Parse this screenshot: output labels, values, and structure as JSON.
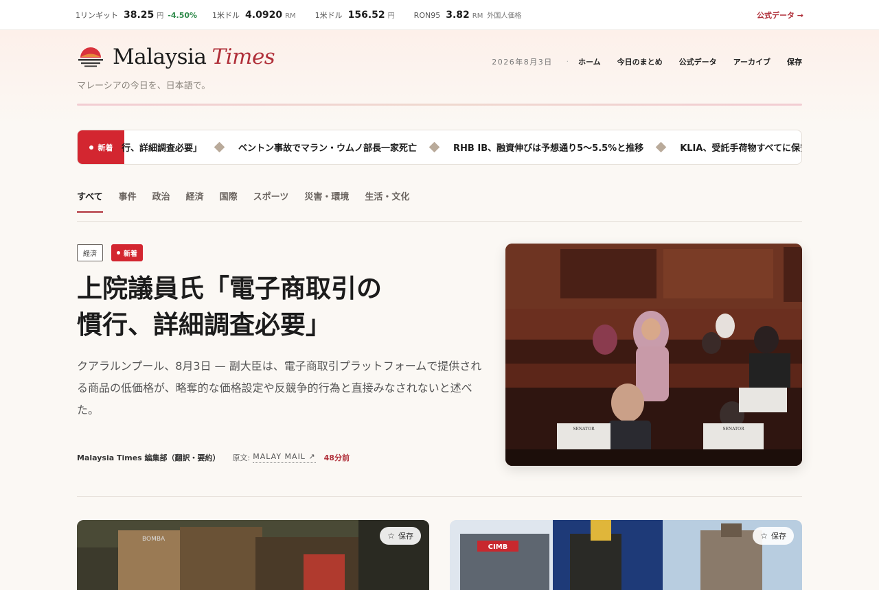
{
  "market": {
    "items": [
      {
        "label": "1リンギット",
        "value": "38.25",
        "unit": "円",
        "change": "-4.50%"
      },
      {
        "label": "1米ドル",
        "value": "4.0920",
        "unit": "RM"
      },
      {
        "label": "1米ドル",
        "value": "156.52",
        "unit": "円"
      },
      {
        "label": "RON95",
        "value": "3.82",
        "unit": "RM",
        "note": "外国人価格"
      }
    ],
    "official_link": "公式データ →",
    "change_color": "#2e8a4a"
  },
  "header": {
    "logo_main": "Malaysia",
    "logo_accent": "Times",
    "tagline": "マレーシアの今日を、日本語で。",
    "date": "2026年8月3日",
    "nav": [
      "ホーム",
      "今日のまとめ",
      "公式データ",
      "アーカイブ",
      "保存"
    ],
    "accent_color": "#b0303a"
  },
  "ticker": {
    "badge": "新着",
    "items": [
      "行、詳細調査必要」",
      "ベントン事故でマラン・ウムノ部長一家死亡",
      "RHB IB、融資伸びは予想通り5〜5.5%と推移",
      "KLIA、受託手荷物すべてに保安"
    ]
  },
  "categories": {
    "tabs": [
      "すべて",
      "事件",
      "政治",
      "経済",
      "国際",
      "スポーツ",
      "災害・環境",
      "生活・文化"
    ],
    "active": "すべて"
  },
  "lead": {
    "category": "経済",
    "new_badge": "新着",
    "title_line1": "上院議員氏「電子商取引の",
    "title_line2": "慣行、詳細調査必要」",
    "summary": "クアラルンプール、8月3日 — 副大臣は、電子商取引プラットフォームで提供される商品の低価格が、略奪的な価格設定や反競争的行為と直接みなされないと述べた。",
    "author": "Malaysia Times 編集部（翻訳・要約）",
    "source_label": "原文:",
    "source": "MALAY MAIL ↗",
    "time": "48分前",
    "image_text": {
      "placard_1_title": "SENATOR",
      "placard_2_title": "SENATOR"
    }
  },
  "cards": [
    {
      "save_label": "保存",
      "image_text": "BOMBA"
    },
    {
      "save_label": "保存",
      "image_text": "CIMB"
    }
  ]
}
